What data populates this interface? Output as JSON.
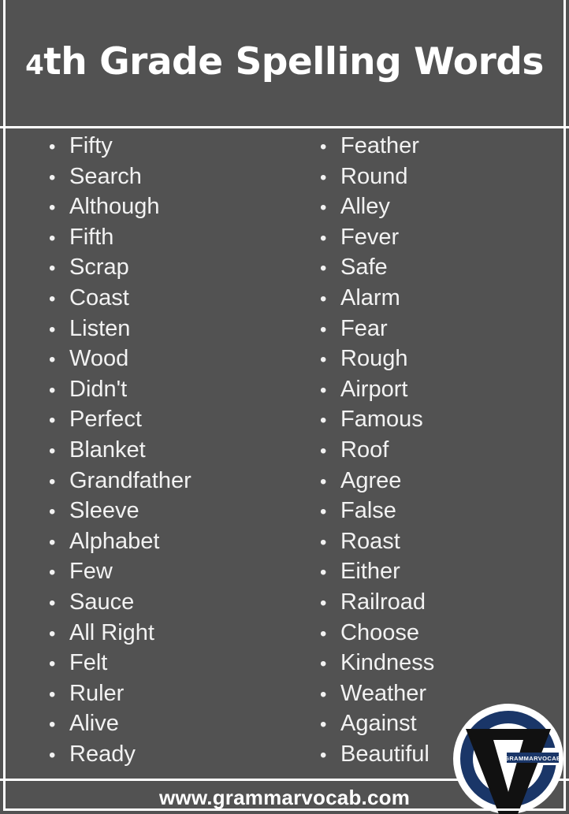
{
  "header": {
    "title_ordinal": "4",
    "title_rest": "th Grade Spelling Words",
    "title_full": "4th Grade Spelling Words"
  },
  "colors": {
    "background": "#525252",
    "text": "#f2f2f2",
    "frame": "#ffffff",
    "logo_navy": "#1a3668",
    "logo_black": "#111111",
    "logo_white": "#ffffff"
  },
  "words": {
    "bullet_glyph": "•",
    "left_column": [
      "Fifty",
      "Search",
      "Although",
      "Fifth",
      "Scrap",
      "Coast",
      "Listen",
      "Wood",
      "Didn't",
      "Perfect",
      "Blanket",
      "Grandfather",
      "Sleeve",
      "Alphabet",
      "Few",
      "Sauce",
      "All Right",
      "Felt",
      "Ruler",
      "Alive",
      "Ready"
    ],
    "right_column": [
      "Feather",
      "Round",
      "Alley",
      "Fever",
      "Safe",
      "Alarm",
      "Fear",
      "Rough",
      "Airport",
      "Famous",
      "Roof",
      "Agree",
      "False",
      "Roast",
      "Either",
      "Railroad",
      "Choose",
      "Kindness",
      "Weather",
      "Against",
      "Beautiful"
    ]
  },
  "footer": {
    "url": "www.grammarvocab.com"
  },
  "logo": {
    "badge_text": "GRAMMARVOCAB"
  }
}
